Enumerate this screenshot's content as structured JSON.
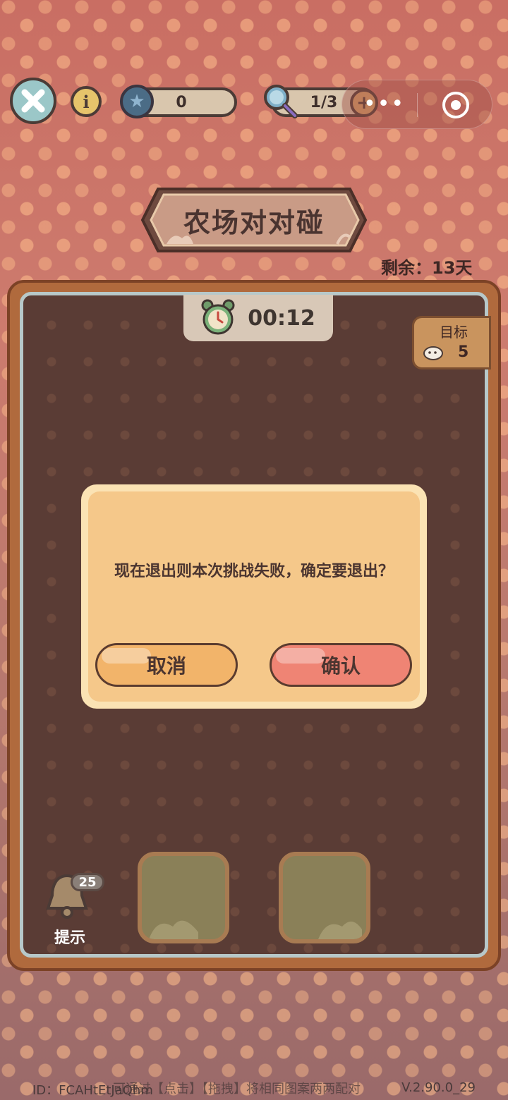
{
  "topbar": {
    "star_count": "0",
    "magnifier_count": "1/3"
  },
  "title": "农场对对碰",
  "remaining": "剩余：13天",
  "timer": "00:12",
  "goal": {
    "label": "目标",
    "count": "5",
    "icon": "animal-icon"
  },
  "hint": {
    "label": "提示",
    "badge": "25"
  },
  "dialog": {
    "message": "现在退出则本次挑战失败，确定要退出？",
    "cancel": "取消",
    "confirm": "确认"
  },
  "footer": {
    "id": "ID：FCAHtEtJaQhm",
    "tip": "可通过【点击】【拖拽】将相同图案两两配对",
    "version": "V.2.90.0_29"
  },
  "colors": {
    "background": "#c96e63",
    "board": "#5a3c35",
    "dialog": "#f5c88a",
    "cancel_button": "#f2b46a",
    "confirm_button": "#ef8474"
  }
}
